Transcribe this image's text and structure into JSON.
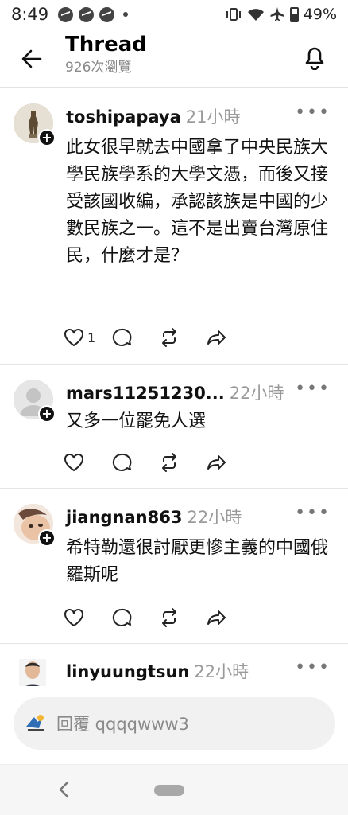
{
  "status_bar": {
    "time": "8:49",
    "battery": "49%"
  },
  "header": {
    "title": "Thread",
    "views": "926次瀏覽"
  },
  "posts": [
    {
      "username": "toshipapaya",
      "time": "21小時",
      "text": "此女很早就去中國拿了中央民族大學民族學系的大學文憑，而後又接受該國收編，承認該族是中國的少數民族之一。這不是出賣台灣原住民，什麼才是？",
      "likes": "1"
    },
    {
      "username": "mars11251230...",
      "time": "22小時",
      "text": "又多一位罷免人選",
      "likes": ""
    },
    {
      "username": "jiangnan863",
      "time": "22小時",
      "text": "希特勒還很討厭更慘主義的中國俄羅斯呢",
      "likes": ""
    },
    {
      "username": "linyuungtsun",
      "time": "22小時",
      "text": "",
      "likes": ""
    }
  ],
  "reply": {
    "placeholder": "回覆 qqqqwww3"
  }
}
